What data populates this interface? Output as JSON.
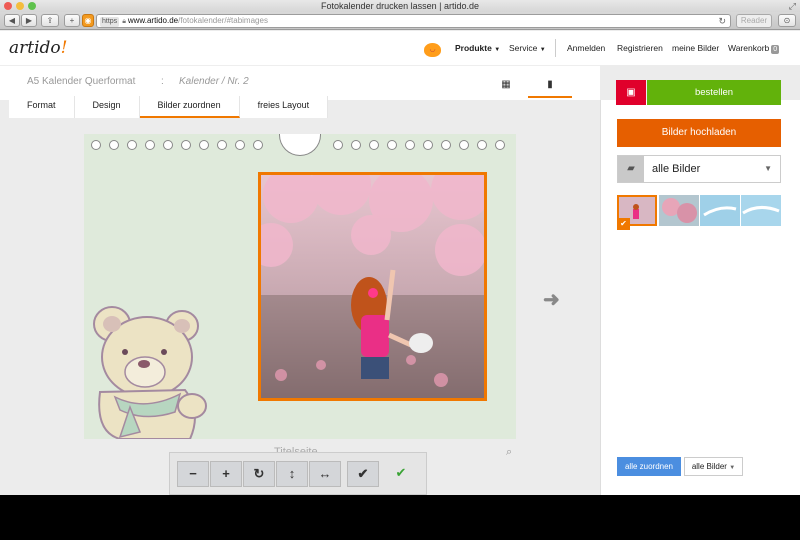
{
  "browser": {
    "window_title": "Fotokalender drucken lassen | artido.de",
    "url_scheme": "https",
    "url_host": "www.artido.de",
    "url_path": "/fotokalender/#tabimages",
    "reader_label": "Reader"
  },
  "site": {
    "logo_text": "artido",
    "logo_bang": "!",
    "nav": {
      "produkte": "Produkte",
      "service": "Service",
      "anmelden": "Anmelden",
      "registrieren": "Registrieren",
      "meine_bilder": "meine Bilder",
      "warenkorb": "Warenkorb",
      "warenkorb_count": "0"
    }
  },
  "project": {
    "name": "A5 Kalender Querformat",
    "separator": ":",
    "subtitle": "Kalender / Nr. 2"
  },
  "tabs": [
    {
      "label": "Format",
      "active": false
    },
    {
      "label": "Design",
      "active": false
    },
    {
      "label": "Bilder zuordnen",
      "active": true
    },
    {
      "label": "freies Layout",
      "active": false
    }
  ],
  "page": {
    "caption": "Titelseite"
  },
  "tools": {
    "minus": "−",
    "plus": "+",
    "rotate": "↻",
    "flip_v": "↕",
    "flip_h": "↔",
    "check": "✔",
    "confirm": "✔"
  },
  "right_panel": {
    "order_label": "bestellen",
    "upload_label": "Bilder hochladen",
    "folder_value": "alle Bilder",
    "assign_all_label": "alle zuordnen",
    "filter_value": "alle Bilder"
  },
  "colors": {
    "accent": "#f07800",
    "order_green": "#62b20b",
    "save_red": "#e0002b",
    "upload_orange": "#e65f00",
    "assign_blue": "#4b8ee0",
    "page_green": "#dfeadb"
  }
}
